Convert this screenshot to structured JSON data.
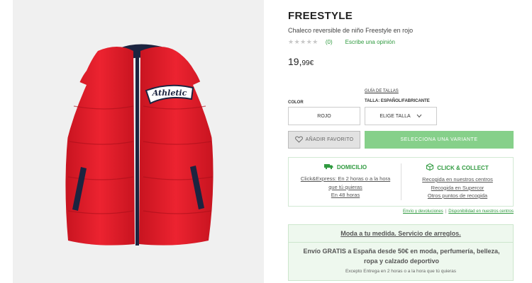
{
  "product": {
    "brand": "FREESTYLE",
    "description": "Chaleco reversible de niño Freestyle en rojo",
    "stars": "★★★★★",
    "review_count": "(0)",
    "review_link": "Escribe una opinión",
    "price_main": "19,",
    "price_cents": "99€",
    "patch_text": "Athletic"
  },
  "selectors": {
    "size_guide": "GUÍA DE TALLAS",
    "color_label": "COLOR",
    "color_value": "ROJO",
    "size_label": "TALLA: ESPAÑOL/FABRICANTE",
    "size_placeholder": "ELIGE TALLA"
  },
  "actions": {
    "favorite": "AÑADIR FAVORITO",
    "variant": "SELECCIONA UNA VARIANTE"
  },
  "delivery": {
    "home_title": "DOMICILIO",
    "home_line1": "Click&Express: En 2 horas o a la hora",
    "home_line2": "que tú quieras",
    "home_line3": "En 48 horas",
    "click_title": "CLICK & COLLECT",
    "click_line1": "Recogida en nuestros centros",
    "click_line2": "Recogida en Supercor",
    "click_line3": "Otros puntos de recogida"
  },
  "links": {
    "shipping": "Envío y devoluciones",
    "availability": "Disponibilidad en nuestros centros"
  },
  "promo": {
    "title": "Moda a tu medida. Servicio de arreglos.",
    "text": "Envío GRATIS a España desde 50€ en moda, perfumería, belleza, ropa y calzado deportivo",
    "small": "Excepto Entrega en 2 horas o a la hora que tú quieras"
  },
  "colors": {
    "green": "#2f9a3f",
    "variant_button": "#86d08a",
    "vest_red": "#e8202e"
  }
}
